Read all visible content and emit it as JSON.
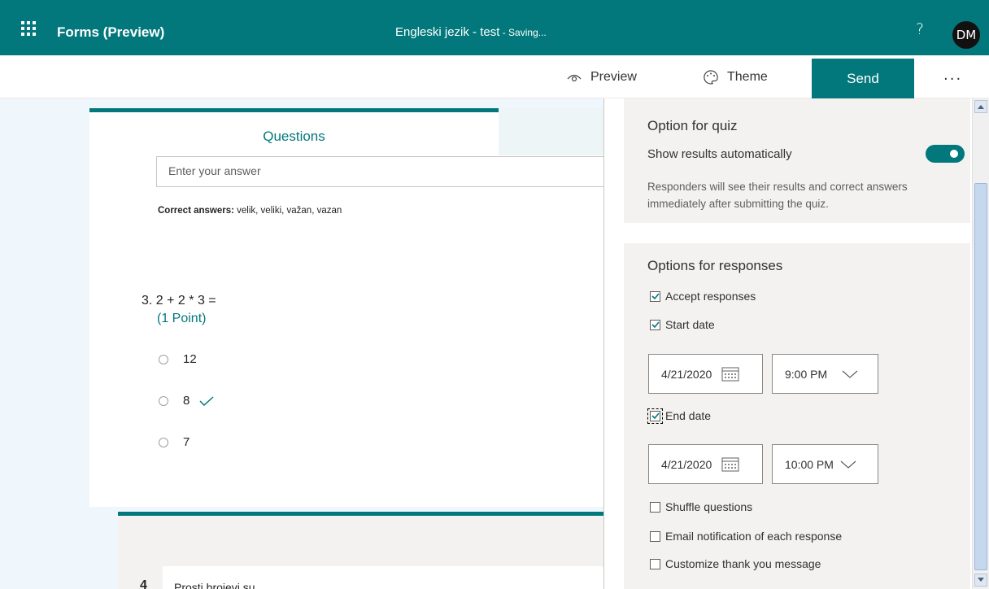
{
  "appbar": {
    "app_name": "Forms (Preview)",
    "doc_title": "Engleski jezik - test",
    "status": " - Saving...",
    "help_label": "?",
    "avatar_initials": "DM"
  },
  "toolbar": {
    "preview_label": "Preview",
    "theme_label": "Theme",
    "send_label": "Send",
    "more_label": "..."
  },
  "editor": {
    "tab_label": "Questions",
    "answer_placeholder": "Enter your answer",
    "correct_label": "Correct answers:",
    "correct_values": " velik, veliki, važan, vazan",
    "question3": {
      "number": "3.",
      "text": "2 + 2 * 3 =",
      "points": "(1 Point)",
      "options": [
        {
          "label": "12",
          "correct": false
        },
        {
          "label": "8",
          "correct": true
        },
        {
          "label": "7",
          "correct": false
        }
      ]
    },
    "question4": {
      "number": "4",
      "text": "Prosti brojevi su"
    }
  },
  "settings": {
    "quiz": {
      "title": "Option for quiz",
      "show_results_label": "Show results automatically",
      "show_results_on": true,
      "description": "Responders will see their results and correct answers immediately after submitting the quiz."
    },
    "responses": {
      "title": "Options for responses",
      "accept_label": "Accept responses",
      "start_label": "Start date",
      "start_date": "4/21/2020",
      "start_time": "9:00 PM",
      "end_label": "End date",
      "end_date": "4/21/2020",
      "end_time": "10:00 PM",
      "shuffle_label": "Shuffle questions",
      "email_label": "Email notification of each response",
      "thanks_label": "Customize thank you message"
    }
  },
  "colors": {
    "brand": "#03787c",
    "surface": "#eff6fc",
    "panel_section": "#f3f2f1"
  }
}
